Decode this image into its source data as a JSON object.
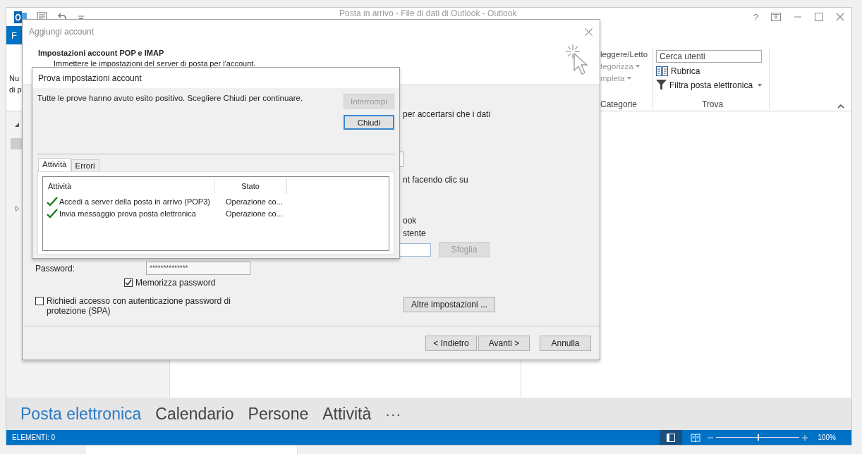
{
  "outlook": {
    "title": "Posta in arrivo - File di dati di Outlook - Outlook",
    "file_tab": "F",
    "ribbon": {
      "new_group": [
        "Nu",
        "di p"
      ],
      "tags_group": {
        "items": [
          {
            "label": "leggere/Letto",
            "dropdown": false,
            "disabled": false
          },
          {
            "label": "tegorizza",
            "dropdown": true,
            "disabled": true
          },
          {
            "label": "mpleta",
            "dropdown": true,
            "disabled": true
          }
        ],
        "caption": "Categorie"
      },
      "find_group": {
        "search": {
          "placeholder": "Cerca utenti"
        },
        "items": [
          {
            "label": "Rubrica",
            "kind": "address-book",
            "dropdown": false
          },
          {
            "label": "Filtra posta elettronica",
            "kind": "filter",
            "dropdown": true
          }
        ],
        "caption": "Trova"
      }
    },
    "navigation": [
      {
        "label": "Posta elettronica",
        "selected": true
      },
      {
        "label": "Calendario",
        "selected": false
      },
      {
        "label": "Persone",
        "selected": false
      },
      {
        "label": "Attività",
        "selected": false
      }
    ],
    "more": "···",
    "help": "?",
    "status_bar": {
      "items_count": "ELEMENTI: 0",
      "zoom": {
        "level": 0.5,
        "reading": "100%"
      }
    }
  },
  "add_account_dialog": {
    "title": "Aggiungi account",
    "heading": "Impostazioni account POP e IMAP",
    "subheading": "Immettere le impostazioni del server di posta per l'account.",
    "partial_texts": [
      "per accertarsi che i dati",
      "nt facendo clic su",
      "ook",
      "stente"
    ],
    "password": {
      "label": "Password:",
      "value": "**************"
    },
    "remember": {
      "label": "Memorizza password",
      "checked": true
    },
    "spa": {
      "label": "Richiedi accesso con autenticazione password di protezione (SPA)",
      "checked": false
    },
    "browse": {
      "label": "Sfoglia",
      "disabled": true
    },
    "more_settings": "Altre impostazioni ...",
    "buttons": [
      "< Indietro",
      "Avanti >",
      "Annulla"
    ]
  },
  "test_dialog": {
    "title": "Prova impostazioni account",
    "message": "Tutte le prove hanno avuto esito positivo. Scegliere Chiudi per continuare.",
    "buttons": [
      {
        "label": "Interrompi",
        "disabled": true,
        "default": false
      },
      {
        "label": "Chiudi",
        "disabled": false,
        "default": true
      }
    ],
    "tabs": [
      {
        "label": "Attività",
        "selected": true
      },
      {
        "label": "Errori",
        "selected": false
      }
    ],
    "columns": [
      "Attività",
      "Stato"
    ],
    "rows": [
      {
        "task": "Accedi a server della posta in arrivo (POP3)",
        "status": "Operazione co...",
        "done": true
      },
      {
        "task": "Invia messaggio prova posta elettronica",
        "status": "Operazione co...",
        "done": true
      }
    ]
  }
}
